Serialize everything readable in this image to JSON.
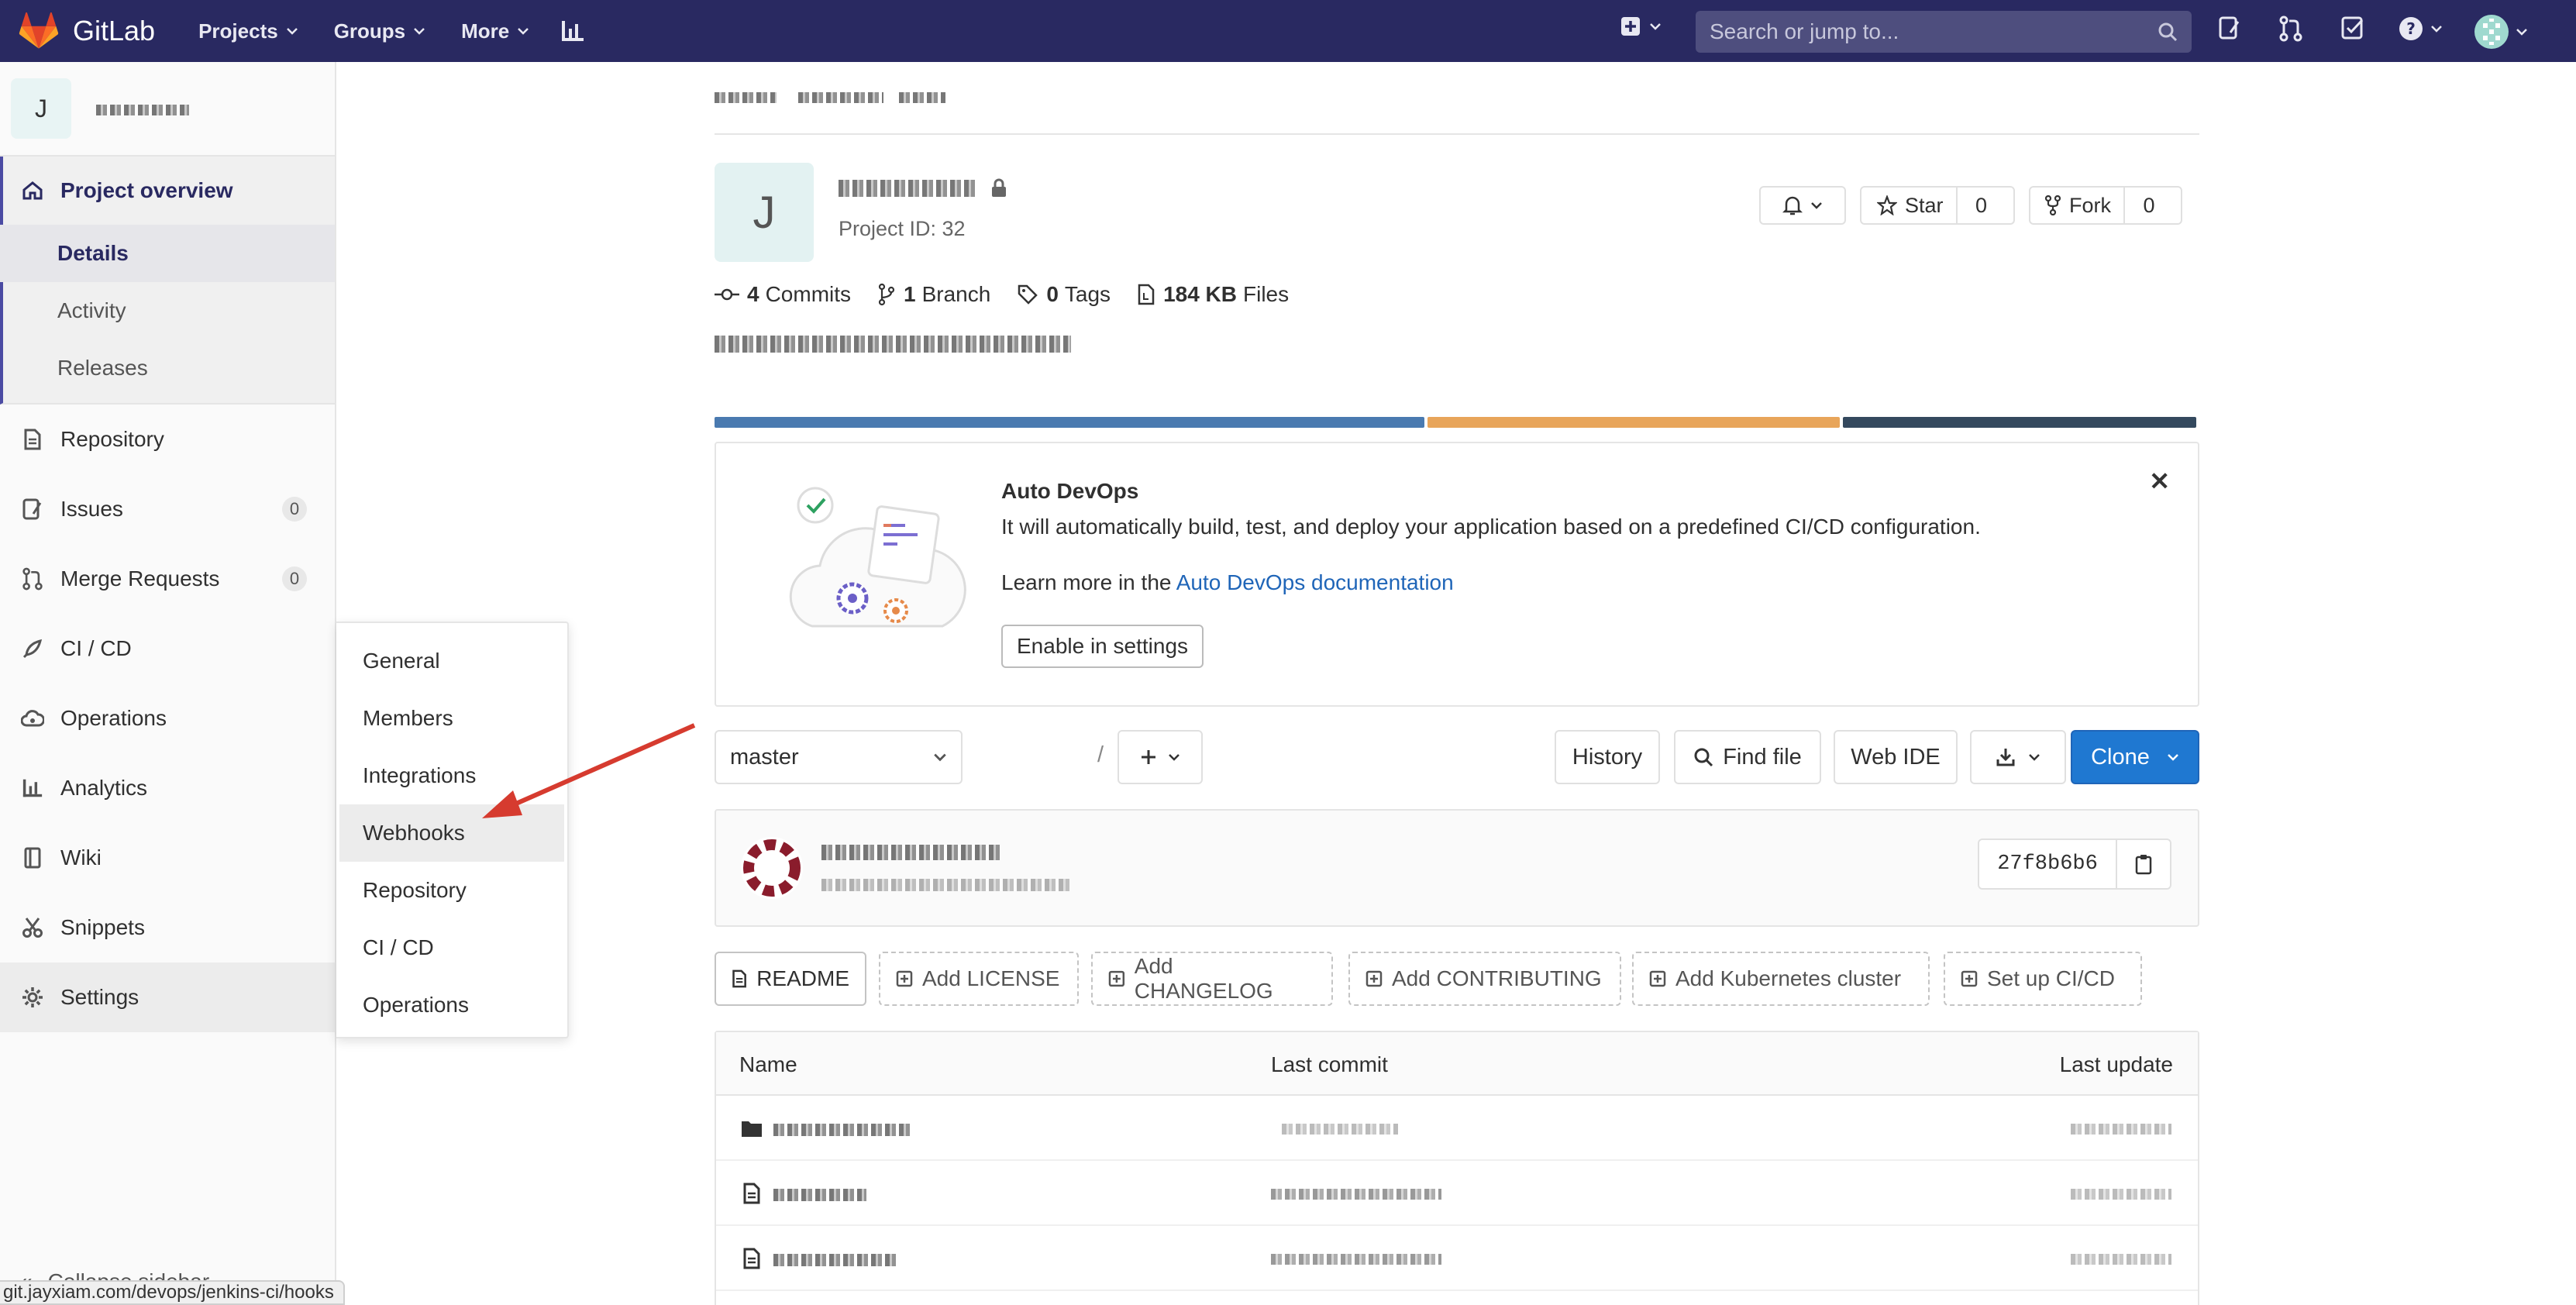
{
  "navbar": {
    "brand": "GitLab",
    "menus": [
      "Projects",
      "Groups",
      "More"
    ],
    "search_placeholder": "Search or jump to..."
  },
  "sidebar": {
    "context_avatar": "J",
    "items": {
      "project_overview": "Project overview",
      "details": "Details",
      "activity": "Activity",
      "releases": "Releases",
      "repository": "Repository",
      "issues": "Issues",
      "issues_count": "0",
      "merge_requests": "Merge Requests",
      "merge_requests_count": "0",
      "cicd": "CI / CD",
      "operations": "Operations",
      "analytics": "Analytics",
      "wiki": "Wiki",
      "snippets": "Snippets",
      "settings": "Settings",
      "collapse": "Collapse sidebar"
    }
  },
  "status_url": "git.jayxiam.com/devops/jenkins-ci/hooks",
  "flyout": {
    "items": [
      "General",
      "Members",
      "Integrations",
      "Webhooks",
      "Repository",
      "CI / CD",
      "Operations"
    ]
  },
  "project": {
    "avatar": "J",
    "id_text": "Project ID: 32",
    "star_label": "Star",
    "star_count": "0",
    "fork_label": "Fork",
    "fork_count": "0",
    "stats": {
      "commits_num": "4",
      "commits_label": "Commits",
      "branch_num": "1",
      "branch_label": "Branch",
      "tags_num": "0",
      "tags_label": "Tags",
      "files_num": "184 KB",
      "files_label": "Files"
    },
    "language_colors": [
      "#4a7ab0",
      "#e8a55a",
      "#34495e"
    ],
    "language_shares": [
      0.48,
      0.28,
      0.24
    ]
  },
  "devops": {
    "title": "Auto DevOps",
    "text": "It will automatically build, test, and deploy your application based on a predefined CI/CD configuration.",
    "learn_prefix": "Learn more in the ",
    "learn_link": "Auto DevOps documentation",
    "button": "Enable in settings"
  },
  "toolbar": {
    "branch": "master",
    "path_sep": "/",
    "history": "History",
    "find_file": "Find file",
    "web_ide": "Web IDE",
    "clone": "Clone"
  },
  "commit": {
    "sha": "27f8b6b6"
  },
  "file_buttons": [
    "README",
    "Add LICENSE",
    "Add CHANGELOG",
    "Add CONTRIBUTING",
    "Add Kubernetes cluster",
    "Set up CI/CD"
  ],
  "table": {
    "headers": [
      "Name",
      "Last commit",
      "Last update"
    ]
  }
}
